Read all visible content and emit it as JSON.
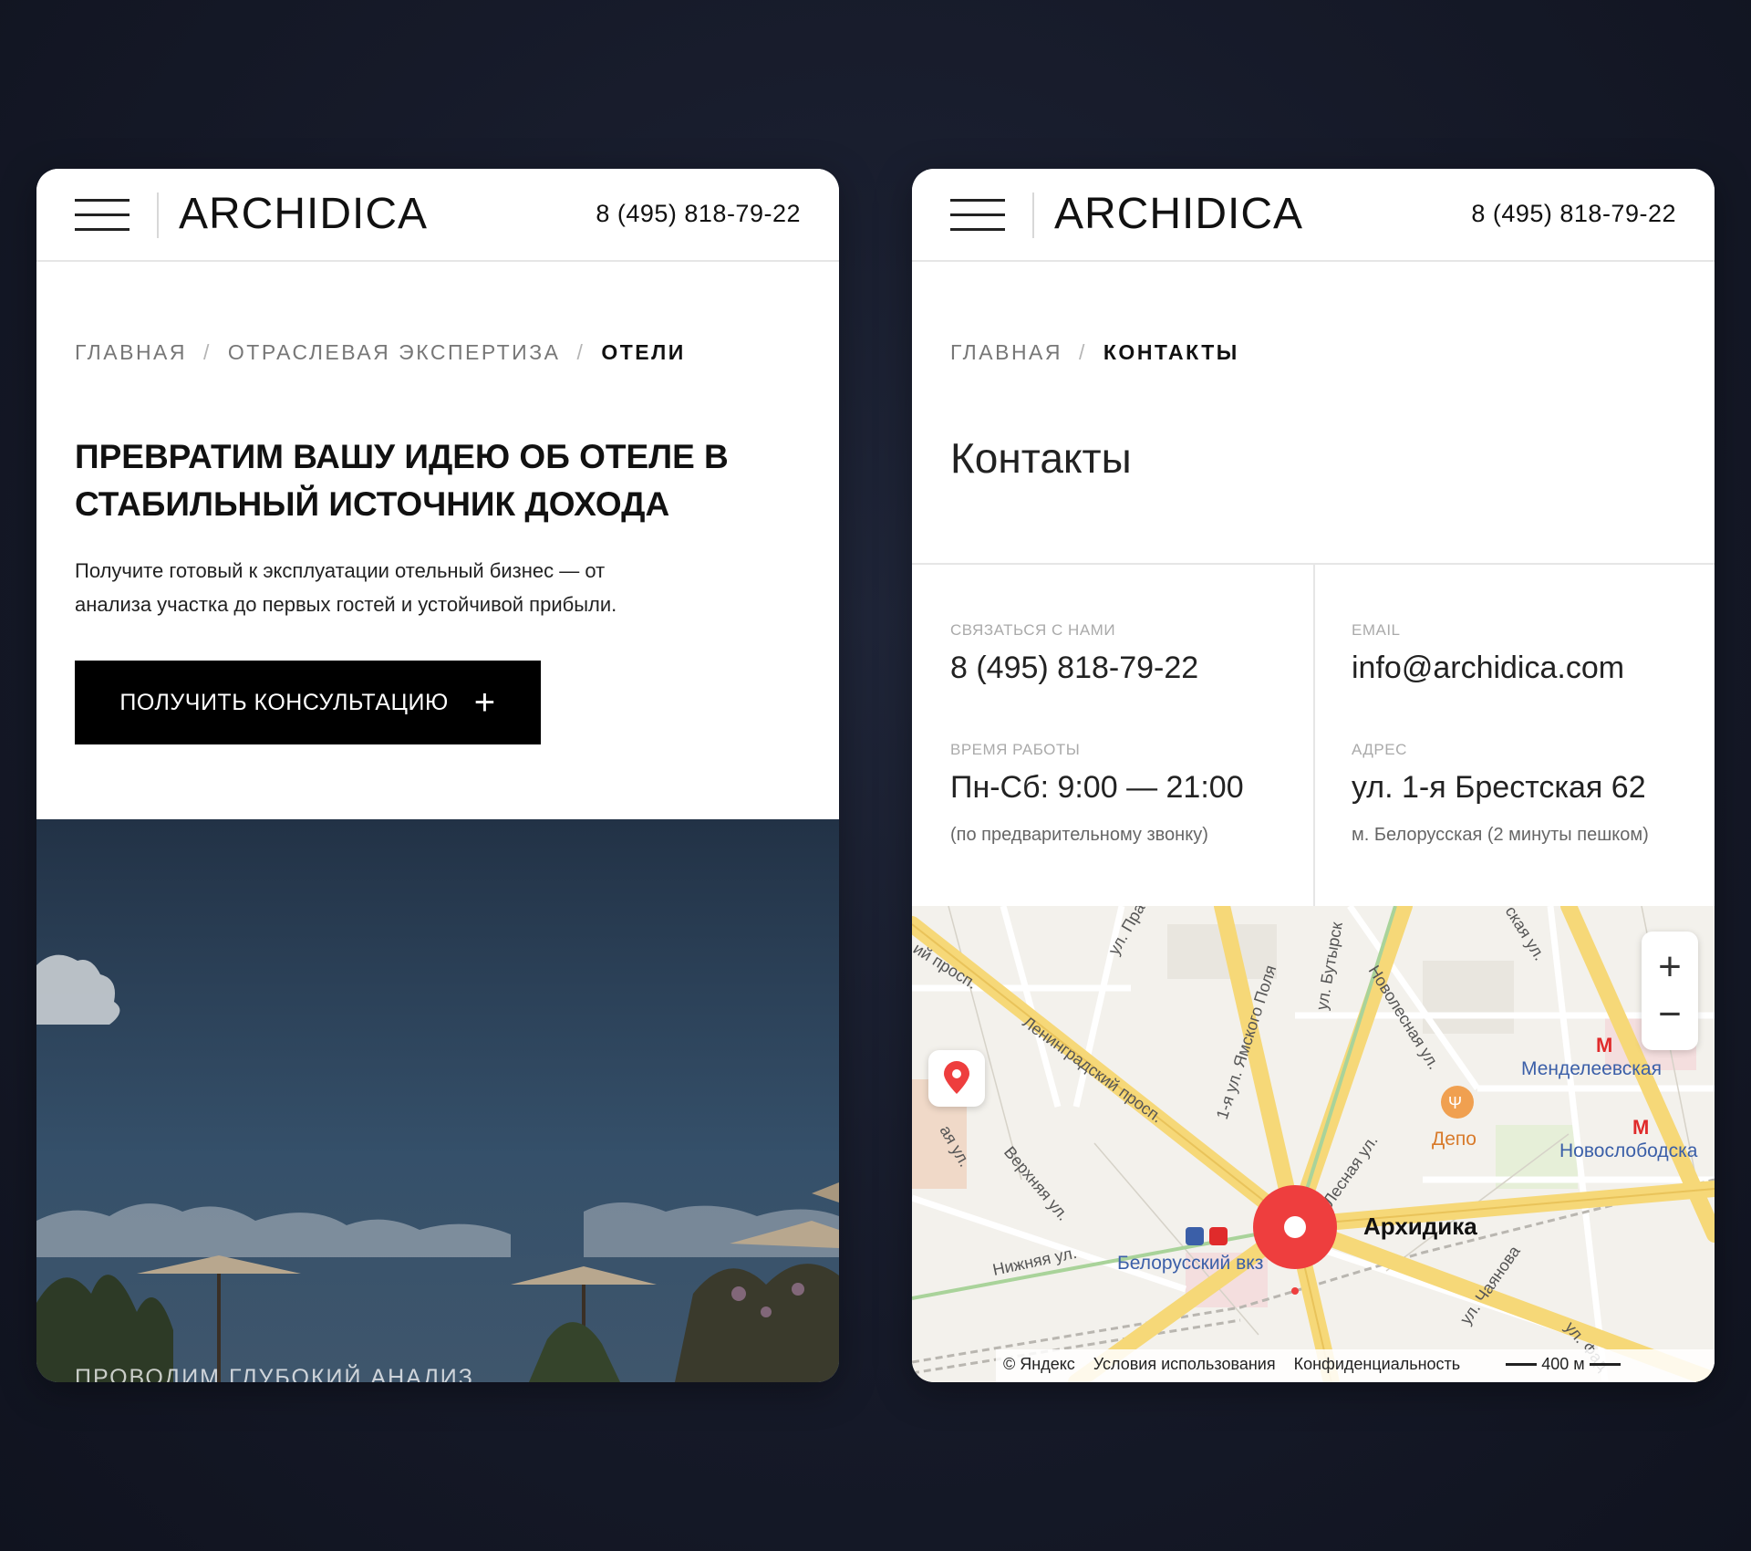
{
  "brand": {
    "logo": "ARCHIDICA",
    "phone": "8 (495) 818-79-22"
  },
  "left": {
    "breadcrumb": [
      "ГЛАВНАЯ",
      "ОТРАСЛЕВАЯ ЭКСПЕРТИЗА",
      "ОТЕЛИ"
    ],
    "hero_title_line1": "ПРЕВРАТИМ ВАШУ ИДЕЮ ОБ ОТЕЛЕ В",
    "hero_title_line2": "СТАБИЛЬНЫЙ ИСТОЧНИК ДОХОДА",
    "hero_sub_line1": "Получите готовый к эксплуатации отельный бизнес — от",
    "hero_sub_line2": "анализа участка до первых гостей и устойчивой прибыли.",
    "cta_label": "ПОЛУЧИТЬ КОНСУЛЬТАЦИЮ",
    "cta_icon": "+",
    "photo_caption": "ПРОВОДИМ ГЛУБОКИЙ АНАЛИЗ"
  },
  "right": {
    "breadcrumb": [
      "ГЛАВНАЯ",
      "КОНТАКТЫ"
    ],
    "heading": "Контакты",
    "contact_label": "СВЯЗАТЬСЯ С НАМИ",
    "contact_phone": "8 (495) 818-79-22",
    "email_label": "EMAIL",
    "email": "info@archidica.com",
    "hours_label": "ВРЕМЯ РАБОТЫ",
    "hours": "Пн-Сб: 9:00 — 21:00",
    "hours_note": "(по предварительному звонку)",
    "address_label": "АДРЕС",
    "address": "ул. 1-я Брестская 62",
    "address_note": "м. Белорусская (2 минуты пешком)"
  },
  "map": {
    "streets": [
      "Ленинградский просп.",
      "1-я ул. Ямского Поля",
      "ул. Бутырск",
      "Новолесная ул.",
      "Лесная ул.",
      "Верхняя ул.",
      "Нижняя ул.",
      "ул. Чаянова",
      "ул. Пра",
      "ий просп.",
      "ая ул.",
      "ул. Фад",
      "ская ул."
    ],
    "places": [
      "Менделеевская",
      "Новослободска",
      "Депо",
      "Белорусский вкз",
      "Архидика"
    ],
    "zoom_in": "+",
    "zoom_out": "−",
    "footer": [
      "© Яндекс",
      "Условия использования",
      "Конфиденциальность",
      "400 м"
    ]
  }
}
